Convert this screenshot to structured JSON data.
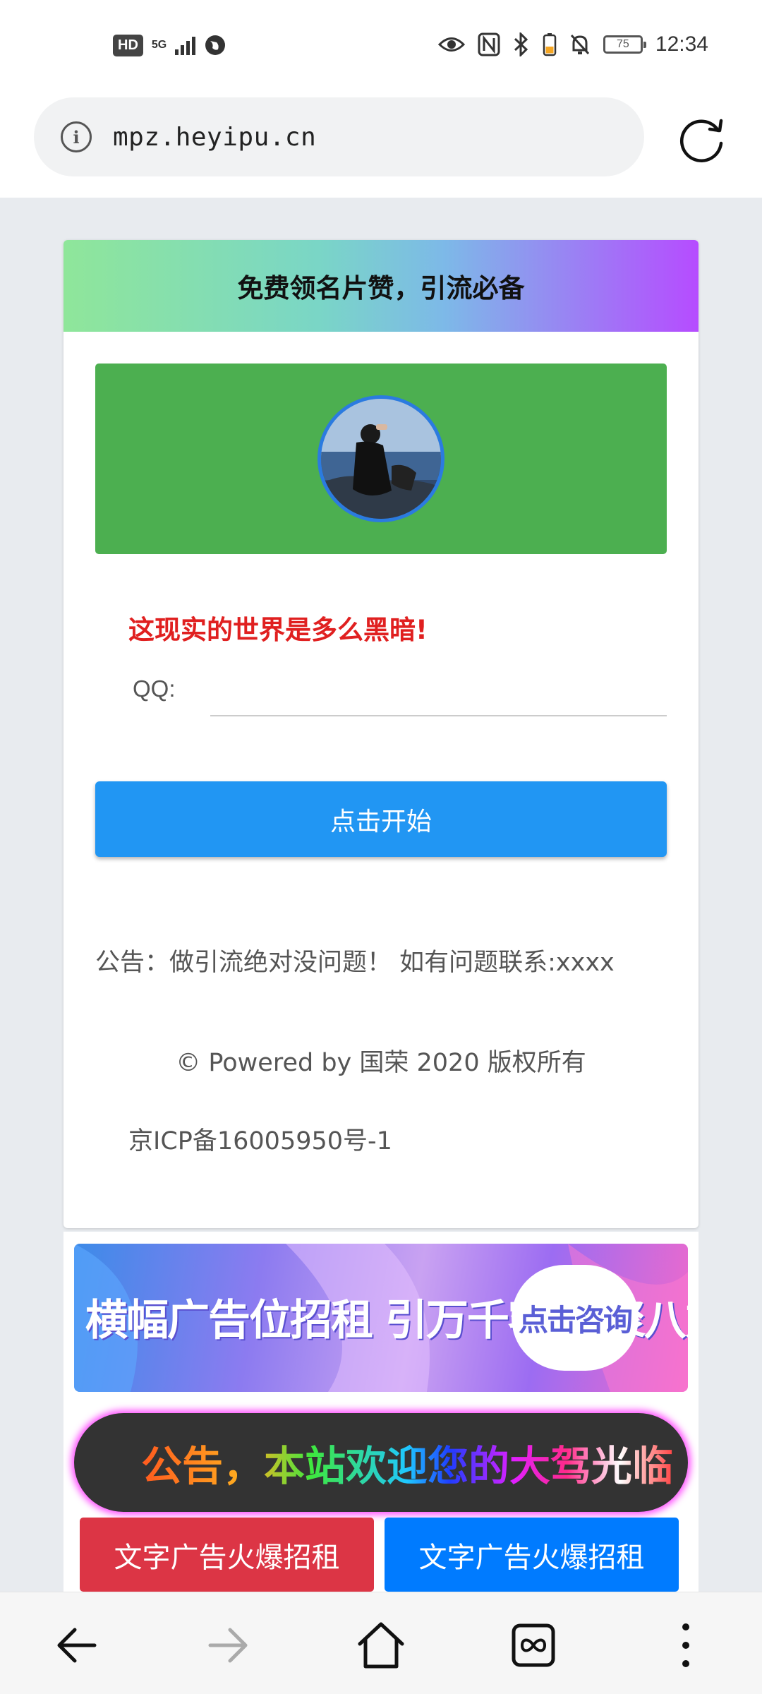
{
  "status_bar": {
    "hd": "HD",
    "network": "5G",
    "battery_level": "75",
    "time": "12:34"
  },
  "browser": {
    "url": "mpz.heyipu.cn"
  },
  "card": {
    "title": "免费领名片赞，引流必备",
    "avatar_alt": "avatar",
    "slogan": "这现实的世界是多么黑暗!",
    "qq_label": "QQ:",
    "qq_value": "",
    "start_button": "点击开始",
    "notice": "公告：做引流绝对没问题！ 如有问题联系:xxxx",
    "powered": "© Powered by 国荣 2020 版权所有",
    "icp": "京ICP备16005950号-1"
  },
  "ads": {
    "banner_text": "横幅广告位招租 引万千客流 聚八方之财气",
    "banner_button": "点击咨询",
    "marquee": "公告，本站欢迎您的大驾光临",
    "text_ad_1": "文字广告火爆招租",
    "text_ad_2": "文字广告火爆招租"
  },
  "colors": {
    "green_box": "#4caf50",
    "start_button": "#2196f3",
    "slogan": "#e02020",
    "ad_red": "#dc3545",
    "ad_blue": "#007bff"
  },
  "nav_icons": [
    "back-icon",
    "forward-icon",
    "home-icon",
    "tabs-icon",
    "menu-icon"
  ]
}
